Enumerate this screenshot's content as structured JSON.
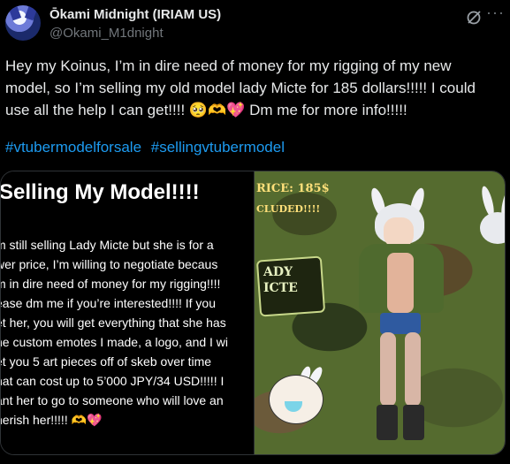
{
  "post": {
    "display_name": "Ōkami Midnight (IRIAM US)",
    "handle": "@Okami_M1dnight",
    "text": "Hey my Koinus, I’m in dire need of money for my rigging of my new model, so I’m selling my old model lady Micte for 185 dollars!!!!! I could use all the help I can get!!!! 🥺🫶💖 Dm me for more info!!!!!",
    "hashtags": [
      "#vtubermodelforsale",
      "#sellingvtubermodel"
    ]
  },
  "media": {
    "left_image": {
      "title": "Selling My Model!!!!",
      "body": "m still selling Lady Micte but she is for a\nwer price, I’m willing to negotiate becaus\nm in dire need of money for my rigging!!!!\nease dm me if you’re interested!!!! If you\net her, you will get everything that she has\nne custom emotes I made, a logo, and I wi\net you 5 art pieces off of skeb over time\nnat can cost up to 5’000 JPY/34 USD!!!!! I\nant her to go to someone who will love an\nnerish her!!!!! 🫶💖"
    },
    "right_image": {
      "price_text": "RICE: 185$",
      "included_text": "CLUDED!!!!",
      "logo_text": "ADY\nICTE"
    }
  },
  "colors": {
    "background": "#000000",
    "text": "#e7e9ea",
    "muted": "#71767b",
    "link": "#1d9bf0"
  },
  "icons": [
    "grok-icon",
    "more-options-icon"
  ]
}
